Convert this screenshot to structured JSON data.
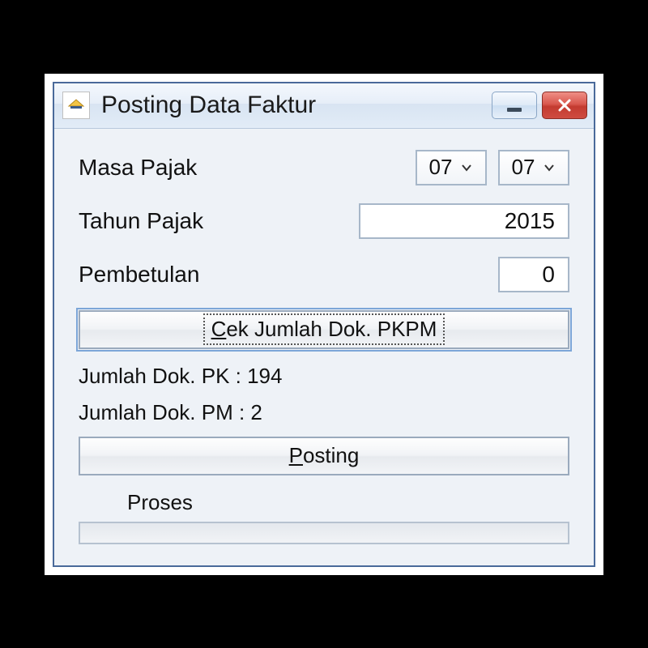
{
  "window": {
    "title": "Posting Data Faktur"
  },
  "form": {
    "masa_label": "Masa Pajak",
    "masa_from": "07",
    "masa_to": "07",
    "tahun_label": "Tahun Pajak",
    "tahun_value": "2015",
    "pembetulan_label": "Pembetulan",
    "pembetulan_value": "0"
  },
  "buttons": {
    "cek_prefix": "C",
    "cek_rest": "ek Jumlah Dok. PKPM",
    "posting_prefix": "P",
    "posting_rest": "osting"
  },
  "status": {
    "pk": "Jumlah Dok. PK : 194",
    "pm": "Jumlah Dok. PM : 2",
    "proses_label": "Proses"
  }
}
